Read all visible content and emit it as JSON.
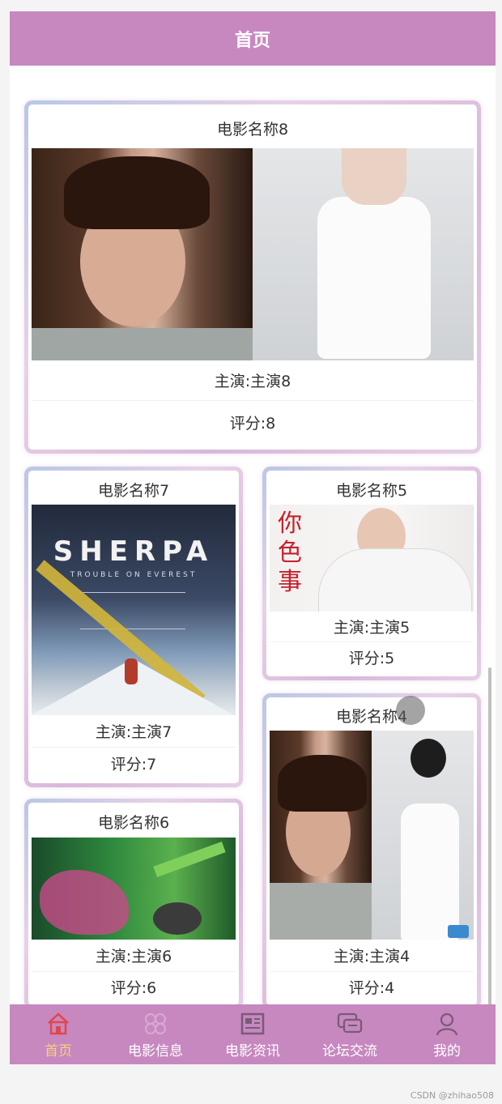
{
  "header": {
    "title": "首页"
  },
  "featured": {
    "title": "电影名称8",
    "actor": "主演:主演8",
    "rating": "评分:8"
  },
  "movies": [
    {
      "title": "电影名称7",
      "actor": "主演:主演7",
      "rating": "评分:7",
      "poster_text": "SHERPA",
      "poster_sub": "TROUBLE ON EVEREST"
    },
    {
      "title": "电影名称5",
      "actor": "主演:主演5",
      "rating": "评分:5",
      "poster_text": "你 色 事"
    },
    {
      "title": "电影名称6",
      "actor": "主演:主演6",
      "rating": "评分:6"
    },
    {
      "title": "电影名称4",
      "actor": "主演:主演4",
      "rating": "评分:4"
    }
  ],
  "nav": [
    {
      "label": "首页",
      "icon": "home-icon",
      "active": true
    },
    {
      "label": "电影信息",
      "icon": "grid-icon"
    },
    {
      "label": "电影资讯",
      "icon": "news-icon"
    },
    {
      "label": "论坛交流",
      "icon": "chat-icon"
    },
    {
      "label": "我的",
      "icon": "user-icon"
    }
  ],
  "colors": {
    "accent": "#c788bf",
    "active_label": "#f7d27a"
  },
  "watermark": "CSDN @zhihao508"
}
